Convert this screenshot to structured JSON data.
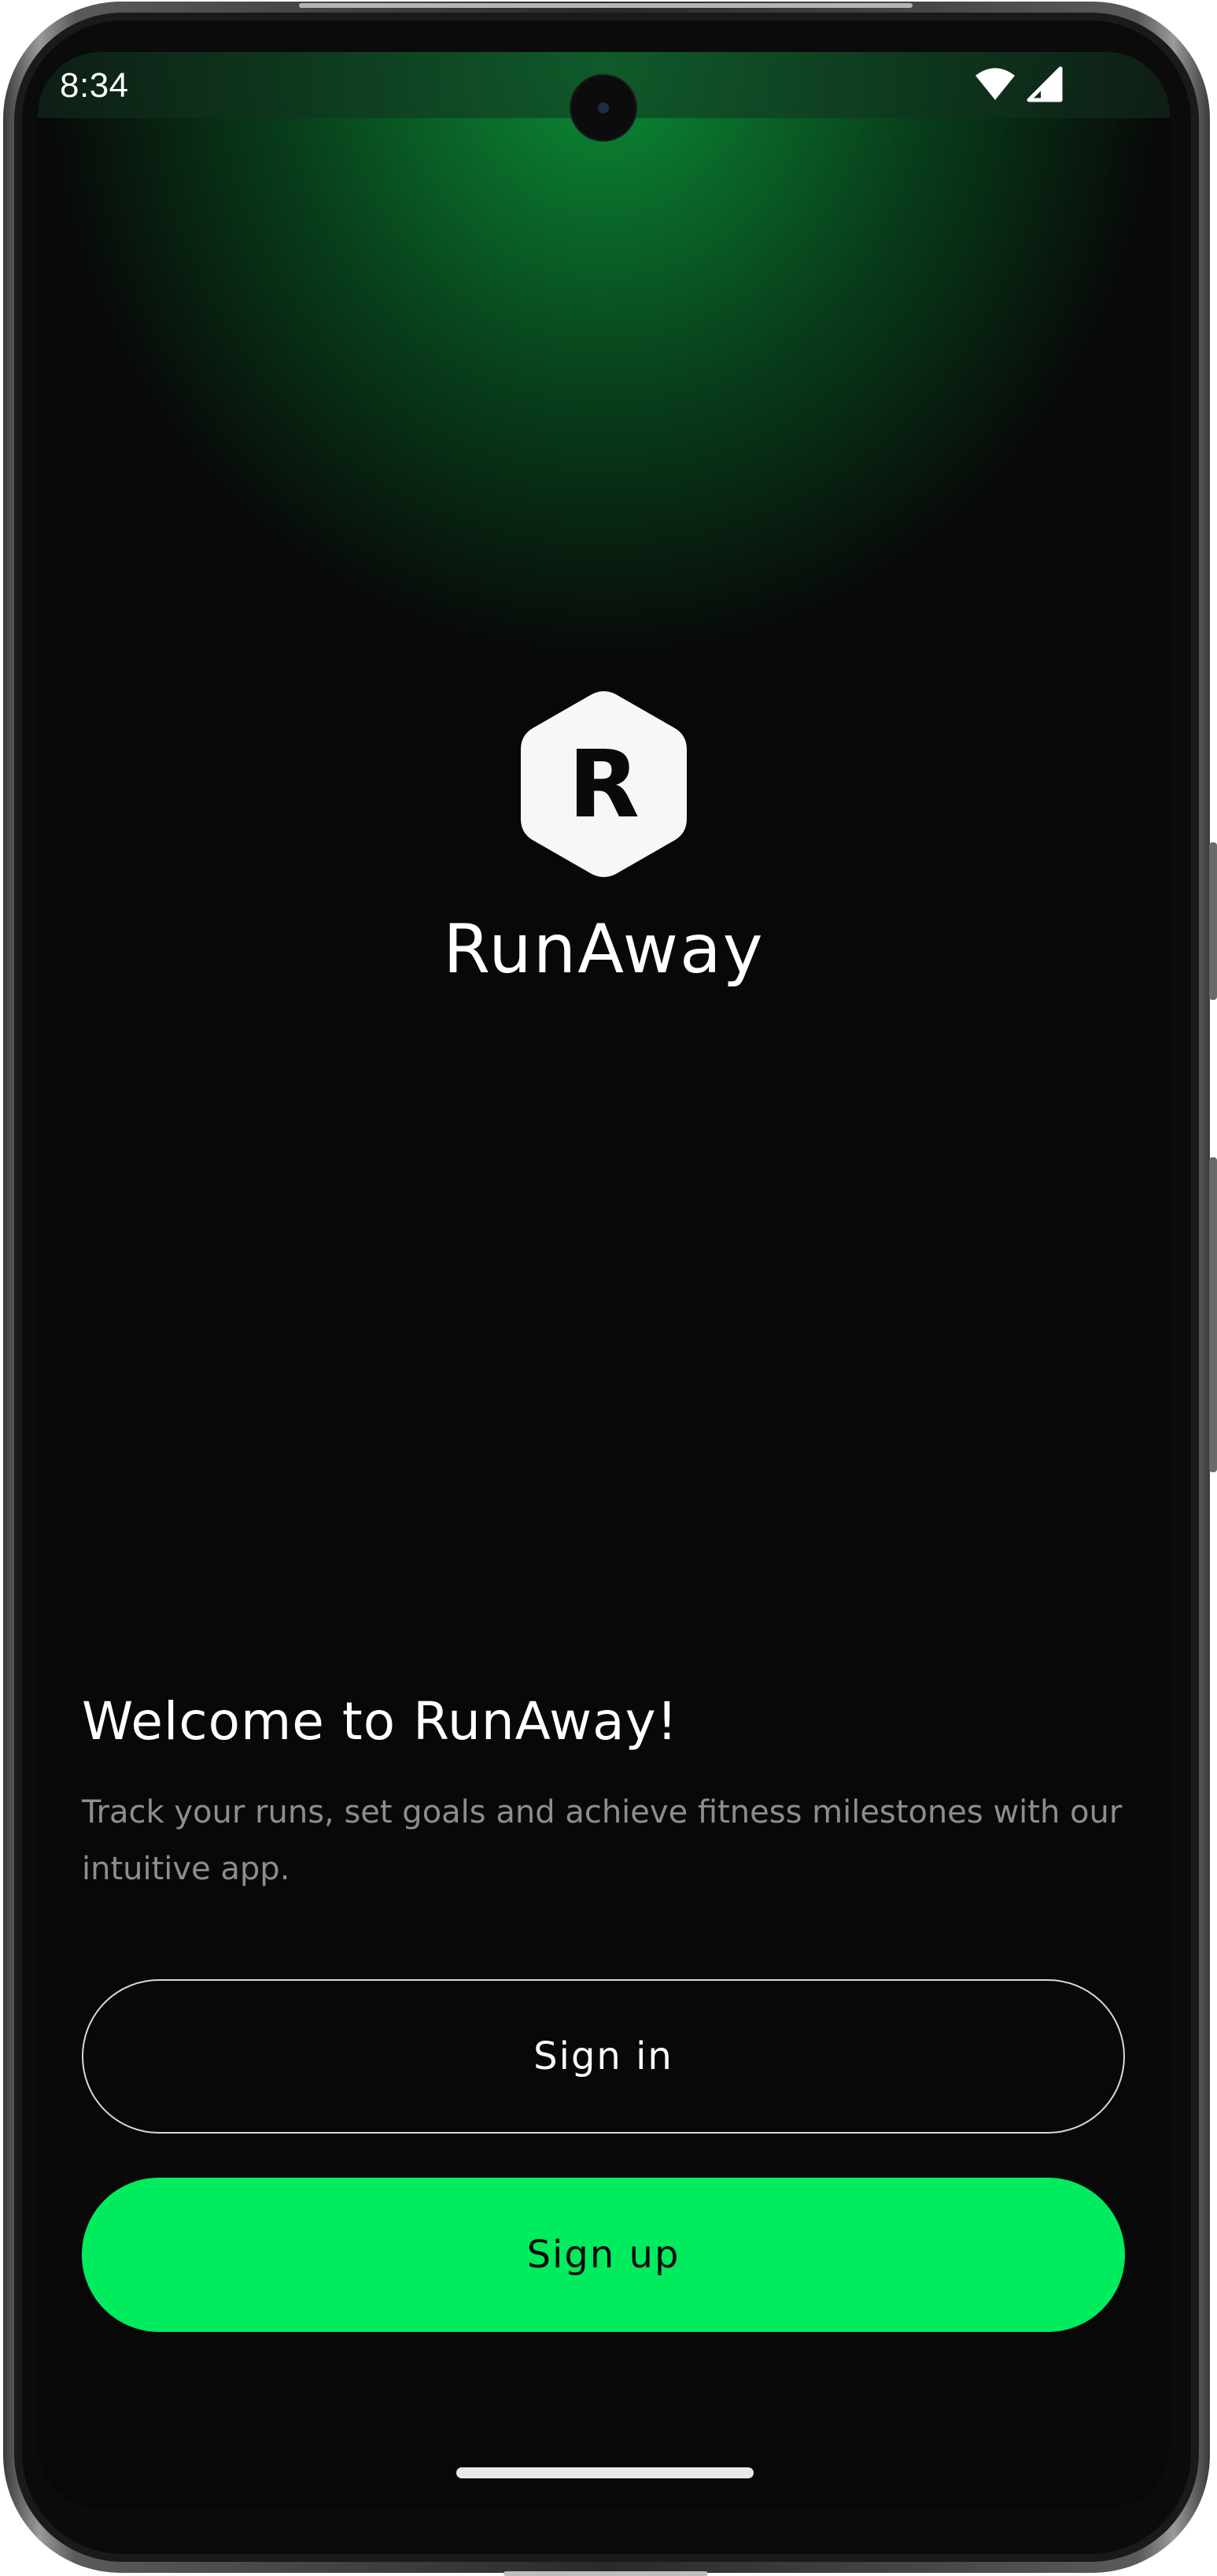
{
  "status_bar": {
    "time": "8:34",
    "icons": [
      "wifi-icon",
      "cellular-signal-icon"
    ]
  },
  "logo": {
    "letter": "R",
    "shape": "hexagon"
  },
  "app_name": "RunAway",
  "welcome": {
    "title": "Welcome to RunAway!",
    "description": "Track your runs, set goals and achieve fitness milestones with our intuitive app."
  },
  "buttons": {
    "sign_in": "Sign in",
    "sign_up": "Sign up"
  },
  "colors": {
    "accent": "#00ec5e",
    "background": "#080808",
    "glow": "#0a8f36",
    "text_primary": "#ffffff",
    "text_secondary": "#8d8d8d"
  }
}
